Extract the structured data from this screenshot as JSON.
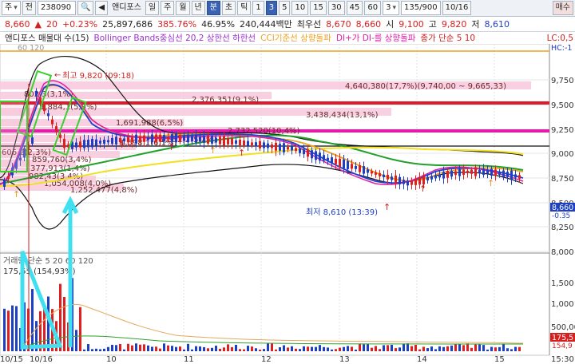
{
  "toolbar": {
    "market": "주",
    "market_type": "전",
    "code": "238090",
    "stock_name": "앤디포스",
    "period_day": "일",
    "period_week": "주",
    "period_month": "월",
    "period_year": "년",
    "period_minute": "분",
    "period_second": "초",
    "period_tick": "틱",
    "intervals": [
      "1",
      "3",
      "5",
      "10",
      "15",
      "30",
      "45",
      "60"
    ],
    "interval_select": "3",
    "count": "135/900",
    "date": "10/16",
    "buy": "매수"
  },
  "quote": {
    "price": "8,660",
    "arrow": "▲",
    "change": "20",
    "change_pct": "+0.23%",
    "volume": "25,897,686",
    "volume_ratio": "385.76%",
    "turnover": "46.95%",
    "trade_value": "240,444백만",
    "hoga": "최우선",
    "ask": "8,670",
    "bid": "8,660",
    "open_label": "시",
    "open": "9,100",
    "high_label": "고",
    "high": "9,820",
    "low_label": "저",
    "low": "8,610"
  },
  "legend": {
    "name": "앤디포스 매물대 수(15)",
    "bollinger": "Bollinger Bands중심선 20,2 상한선 하한선",
    "cci": "CCI기준선 상향돌파",
    "dmi": "DI+가 DI-를 상향돌파",
    "ma": "종가 단순 5 10",
    "lc": "LC:0,5",
    "hc": "HC:-1"
  },
  "chart_data": {
    "type": "candlestick",
    "price_axis": {
      "ticks": [
        "9,750",
        "9,500",
        "9,250",
        "9,000",
        "8,750",
        "8,500",
        "8,250",
        "8,000"
      ],
      "current": "8,660",
      "current_sub": "-0.35"
    },
    "volume_axis": {
      "ticks": [
        "1,500",
        "1,000",
        "500,000"
      ],
      "current": "175,5",
      "current_sub": "154,9"
    },
    "x_labels": [
      "10/15",
      "10/16",
      "10",
      "11",
      "12",
      "13",
      "14",
      "15"
    ],
    "time_label": "15:30",
    "annotations": {
      "high": "최고 9,820 (09:18)",
      "low": "최저 8,610 (13:39)",
      "top_left": "60 120",
      "volume_legend": "거래량 단순 5 20 60 120",
      "volume_val": "175,55 (154,93%)"
    },
    "volume_profile": [
      "4,640,380(17,7%)(9,740,00 ~ 9,665,33)",
      "2,376,351(9,1%)",
      "3,438,434(13,1%)",
      "1,691,988(6,5%)",
      "2,732,520(10,4%)",
      "802,3(3,1%)",
      "1,884,1(5,9%)",
      "606,2(2,3%)",
      "859,760(3,4%)",
      "377,913(1,4%)",
      "982,43(3,4%)",
      "1,054,008(4,0%)",
      "1,252,477(4,8%)",
      "1,598,1(6,1%)",
      "1,352,2(5,2%)"
    ]
  }
}
